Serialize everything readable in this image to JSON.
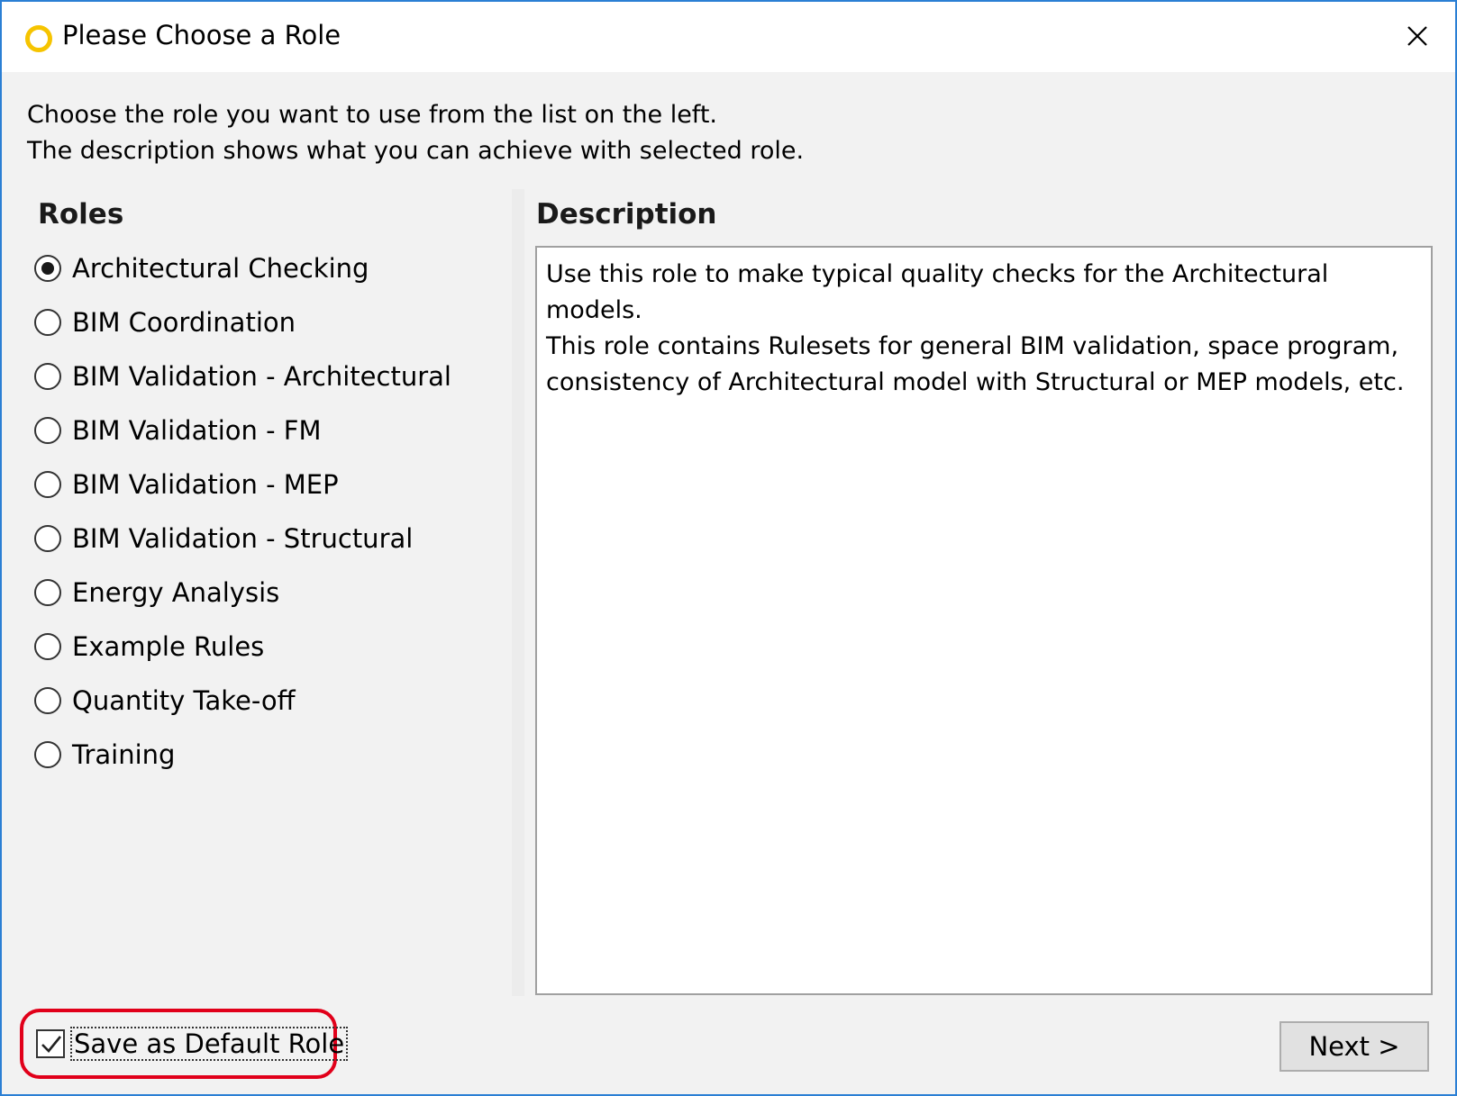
{
  "window": {
    "title": "Please Choose a Role",
    "accent_color": "#2b7fd4",
    "app_icon": "yellow-ring-icon",
    "close_icon": "close-icon"
  },
  "intro": {
    "line1": "Choose the role you want to use from the list on the left.",
    "line2": "The description shows what you can achieve with selected role."
  },
  "roles": {
    "heading": "Roles",
    "selected_index": 0,
    "items": [
      {
        "label": "Architectural Checking",
        "checked": true
      },
      {
        "label": "BIM Coordination",
        "checked": false
      },
      {
        "label": "BIM Validation - Architectural",
        "checked": false
      },
      {
        "label": "BIM Validation - FM",
        "checked": false
      },
      {
        "label": "BIM Validation - MEP",
        "checked": false
      },
      {
        "label": "BIM Validation - Structural",
        "checked": false
      },
      {
        "label": "Energy Analysis",
        "checked": false
      },
      {
        "label": "Example Rules",
        "checked": false
      },
      {
        "label": "Quantity Take-off",
        "checked": false
      },
      {
        "label": "Training",
        "checked": false
      }
    ]
  },
  "description": {
    "heading": "Description",
    "text": "Use this role to make typical quality checks for the Architectural models.\nThis role contains Rulesets for general BIM validation, space program,\nconsistency of Architectural model with Structural or MEP models, etc."
  },
  "footer": {
    "save_default_label": "Save as Default Role",
    "save_default_checked": true,
    "highlight_color": "#e1001a",
    "next_label": "Next >"
  }
}
